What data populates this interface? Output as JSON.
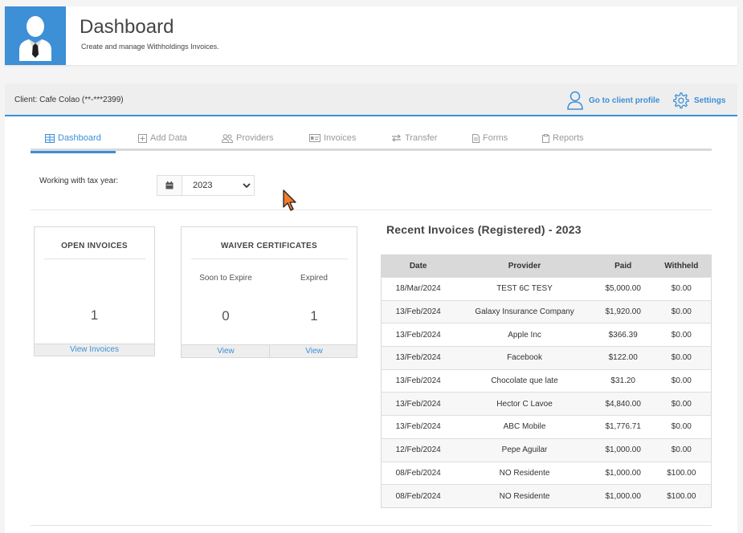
{
  "header": {
    "title": "Dashboard",
    "subtitle": "Create and manage Withholdings Invoices."
  },
  "client_bar": {
    "client_label": "Client: Cafe Colao (**-***2399)",
    "profile_link": "Go to client profile",
    "settings_link": "Settings"
  },
  "tabs": [
    {
      "label": "Dashboard",
      "icon": "table-icon",
      "active": true
    },
    {
      "label": "Add Data",
      "icon": "plus-square-icon",
      "active": false
    },
    {
      "label": "Providers",
      "icon": "users-icon",
      "active": false
    },
    {
      "label": "Invoices",
      "icon": "id-card-icon",
      "active": false
    },
    {
      "label": "Transfer",
      "icon": "exchange-icon",
      "active": false
    },
    {
      "label": "Forms",
      "icon": "file-icon",
      "active": false
    },
    {
      "label": "Reports",
      "icon": "clipboard-icon",
      "active": false
    }
  ],
  "tax_year": {
    "label": "Working with tax year:",
    "selected": "2023"
  },
  "open_invoices": {
    "title": "OPEN INVOICES",
    "count": "1",
    "link": "View Invoices"
  },
  "waiver": {
    "title": "WAIVER CERTIFICATES",
    "soon_label": "Soon to Expire",
    "soon_count": "0",
    "expired_label": "Expired",
    "expired_count": "1",
    "soon_link": "View",
    "expired_link": "View"
  },
  "recent": {
    "title": "Recent Invoices (Registered) - 2023",
    "columns": [
      "Date",
      "Provider",
      "Paid",
      "Withheld"
    ],
    "rows": [
      [
        "18/Mar/2024",
        "TEST 6C TESY",
        "$5,000.00",
        "$0.00"
      ],
      [
        "13/Feb/2024",
        "Galaxy Insurance Company",
        "$1,920.00",
        "$0.00"
      ],
      [
        "13/Feb/2024",
        "Apple Inc",
        "$366.39",
        "$0.00"
      ],
      [
        "13/Feb/2024",
        "Facebook",
        "$122.00",
        "$0.00"
      ],
      [
        "13/Feb/2024",
        "Chocolate que late",
        "$31.20",
        "$0.00"
      ],
      [
        "13/Feb/2024",
        "Hector C Lavoe",
        "$4,840.00",
        "$0.00"
      ],
      [
        "13/Feb/2024",
        "ABC Mobile",
        "$1,776.71",
        "$0.00"
      ],
      [
        "12/Feb/2024",
        "Pepe Aguilar",
        "$1,000.00",
        "$0.00"
      ],
      [
        "08/Feb/2024",
        "NO Residente",
        "$1,000.00",
        "$100.00"
      ],
      [
        "08/Feb/2024",
        "NO Residente",
        "$1,000.00",
        "$100.00"
      ]
    ]
  },
  "colors": {
    "accent": "#3d8fd6",
    "cursor": "#f07c2c"
  }
}
